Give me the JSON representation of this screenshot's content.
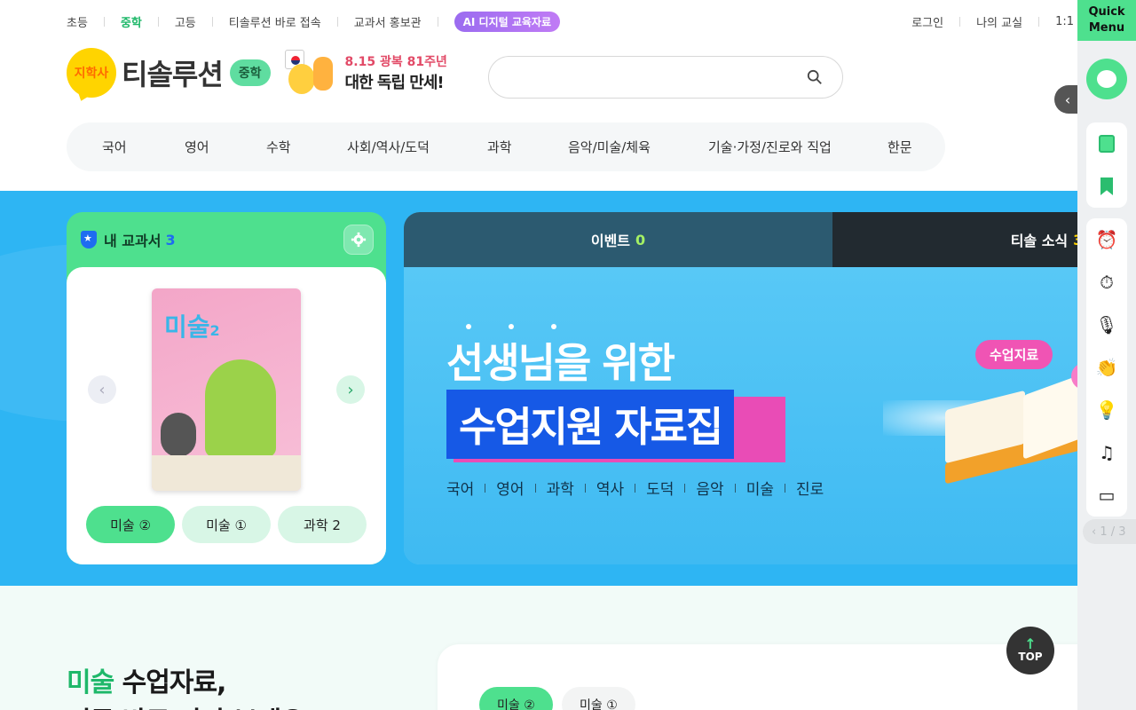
{
  "topbar": {
    "left": [
      {
        "label": "초등",
        "active": false
      },
      {
        "label": "중학",
        "active": true
      },
      {
        "label": "고등",
        "active": false
      },
      {
        "label": "티솔루션 바로 접속",
        "active": false
      },
      {
        "label": "교과서 홍보관",
        "active": false
      }
    ],
    "ai_label": "AI 디지털 교육자료",
    "right": [
      "로그인",
      "나의 교실",
      "1:1"
    ]
  },
  "logo": {
    "badge": "지학사",
    "name": "티솔루션",
    "level": "중학"
  },
  "promo": {
    "date": "8.15 광복 81주년",
    "main": "대한 독립 만세!"
  },
  "search": {
    "placeholder": "",
    "icon": "search-icon"
  },
  "subjects": [
    "국어",
    "영어",
    "수학",
    "사회/역사/도덕",
    "과학",
    "음악/미술/체육",
    "기술·가정/진로와 직업",
    "한문"
  ],
  "my_books": {
    "title": "내 교과서",
    "count": "3",
    "cover_title": "미술",
    "cover_num": "2",
    "tabs": [
      {
        "label": "미술 ②",
        "active": true
      },
      {
        "label": "미술 ①",
        "active": false
      },
      {
        "label": "과학 2",
        "active": false
      }
    ]
  },
  "news": {
    "tabs": [
      {
        "label": "이벤트",
        "count": "0"
      },
      {
        "label": "티솔 소식",
        "count": "3"
      }
    ],
    "banner": {
      "line1": "선생님을 위한",
      "line2": "수업지원 자료집",
      "subjects": [
        "국어",
        "영어",
        "과학",
        "역사",
        "도덕",
        "음악",
        "미술",
        "진로"
      ],
      "pill": "수업지료"
    }
  },
  "lower": {
    "title_hl": "미술",
    "title_rest": " 수업자료,",
    "title_line2": "지금 바로 만나 보세요",
    "tabs": [
      "미술 ②",
      "미술 ①"
    ]
  },
  "top_button": "TOP",
  "quick_menu": {
    "title1": "Quick",
    "title2": "Menu",
    "pager": "1 / 3"
  }
}
